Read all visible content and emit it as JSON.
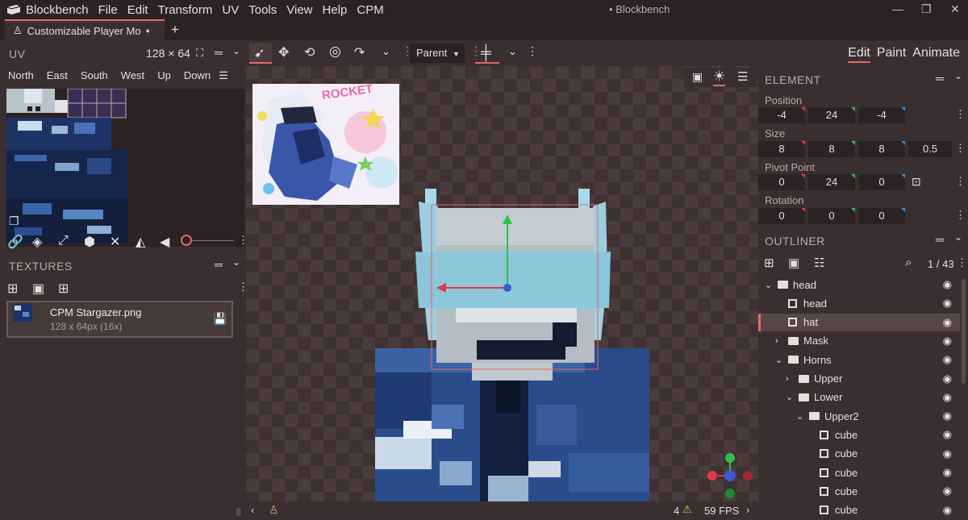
{
  "app": {
    "name": "Blockbench",
    "window_title": "• Blockbench"
  },
  "menu": [
    "File",
    "Edit",
    "Transform",
    "UV",
    "Tools",
    "View",
    "Help",
    "CPM"
  ],
  "tab": {
    "label": "Customizable Player Mo",
    "dot": "●",
    "new": "+"
  },
  "uv_panel": {
    "title": "UV",
    "size": "128 × 64",
    "faces": [
      "North",
      "East",
      "South",
      "West",
      "Up",
      "Down"
    ]
  },
  "textures_panel": {
    "title": "TEXTURES",
    "item": {
      "name": "CPM Stargazer.png",
      "info": "128 x 64px (16x)"
    }
  },
  "toolbar": {
    "parent_select": "Parent"
  },
  "modes": {
    "edit": "Edit",
    "paint": "Paint",
    "animate": "Animate"
  },
  "element_panel": {
    "title": "ELEMENT",
    "position": {
      "label": "Position",
      "values": [
        "-4",
        "24",
        "-4"
      ]
    },
    "size": {
      "label": "Size",
      "values": [
        "8",
        "8",
        "8",
        "0.5"
      ]
    },
    "pivot": {
      "label": "Pivot Point",
      "values": [
        "0",
        "24",
        "0"
      ]
    },
    "rotation": {
      "label": "Rotation",
      "values": [
        "0",
        "0",
        "0"
      ]
    }
  },
  "outliner": {
    "title": "OUTLINER",
    "count": "1 / 43",
    "items": [
      {
        "label": "head",
        "type": "group",
        "indent": 0,
        "arrow": "down"
      },
      {
        "label": "head",
        "type": "cube",
        "indent": 1,
        "arrow": ""
      },
      {
        "label": "hat",
        "type": "cube",
        "indent": 1,
        "arrow": "",
        "selected": true
      },
      {
        "label": "Mask",
        "type": "group",
        "indent": 1,
        "arrow": "right"
      },
      {
        "label": "Horns",
        "type": "group",
        "indent": 1,
        "arrow": "down"
      },
      {
        "label": "Upper",
        "type": "group",
        "indent": 2,
        "arrow": "right"
      },
      {
        "label": "Lower",
        "type": "group",
        "indent": 2,
        "arrow": "down"
      },
      {
        "label": "Upper2",
        "type": "group",
        "indent": 3,
        "arrow": "down"
      },
      {
        "label": "cube",
        "type": "cube",
        "indent": 4,
        "arrow": ""
      },
      {
        "label": "cube",
        "type": "cube",
        "indent": 4,
        "arrow": ""
      },
      {
        "label": "cube",
        "type": "cube",
        "indent": 4,
        "arrow": ""
      },
      {
        "label": "cube",
        "type": "cube",
        "indent": 4,
        "arrow": ""
      },
      {
        "label": "cube",
        "type": "cube",
        "indent": 4,
        "arrow": ""
      }
    ]
  },
  "reference_image": {
    "caption": "ROCKET"
  },
  "status": {
    "warnings": "4",
    "fps": "59 FPS"
  },
  "colors": {
    "accent": "#e06a6a",
    "bg": "#3a2f30",
    "menubar": "#2b2223",
    "axis_x": "#e0384a",
    "axis_y": "#2fc04a",
    "axis_z": "#3a5ad0"
  }
}
